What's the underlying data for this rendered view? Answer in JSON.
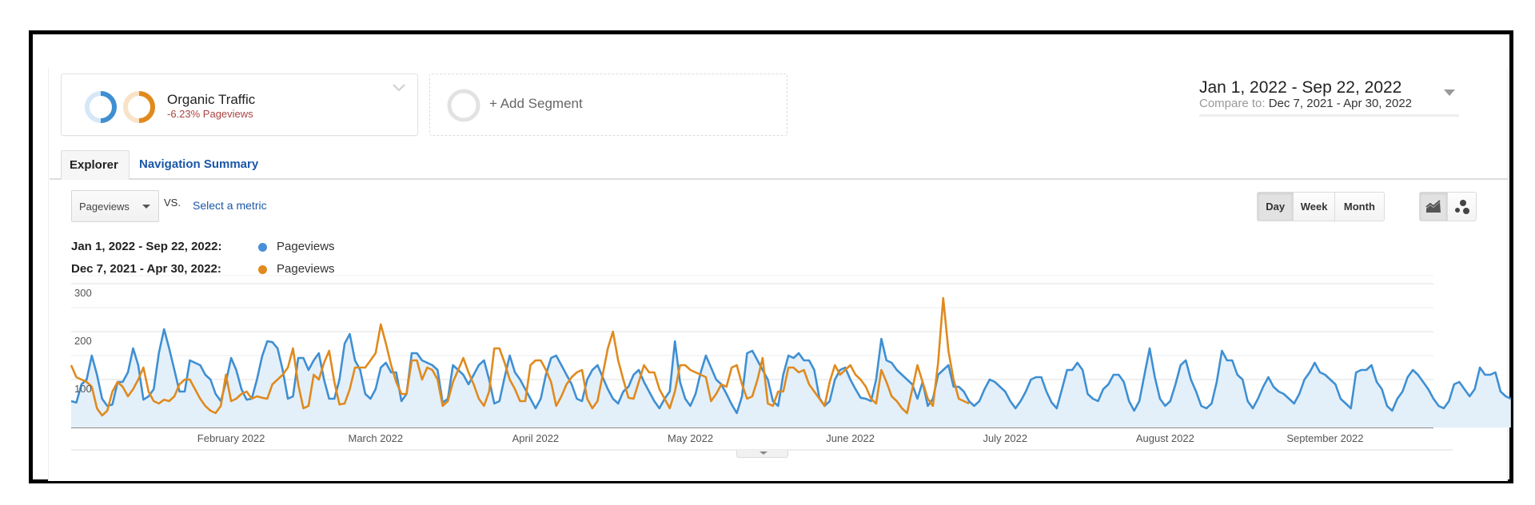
{
  "segment": {
    "name": "Organic Traffic",
    "change": "-6.23% Pageviews",
    "add_label": "+ Add Segment"
  },
  "date_range": {
    "primary": "Jan 1, 2022 - Sep 22, 2022",
    "compare_prefix": "Compare to: ",
    "compare": "Dec 7, 2021 - Apr 30, 2022"
  },
  "tabs": [
    {
      "label": "Explorer",
      "active": true
    },
    {
      "label": "Navigation Summary",
      "active": false
    }
  ],
  "toolbar": {
    "metric": "Pageviews",
    "vs_label": "VS.",
    "select_metric": "Select a metric",
    "period_buttons": [
      "Day",
      "Week",
      "Month"
    ],
    "active_period": "Day",
    "view_icons": [
      "line-chart-icon",
      "motion-chart-icon"
    ]
  },
  "legend": [
    {
      "range": "Jan 1, 2022 - Sep 22, 2022:",
      "metric": "Pageviews",
      "color": "#4a90d9"
    },
    {
      "range": "Dec 7, 2021 - Apr 30, 2022:",
      "metric": "Pageviews",
      "color": "#e08a1e"
    }
  ],
  "colors": {
    "primary": "#3f8fd2",
    "compare": "#e08a1e",
    "area_fill": "#e3f0fa",
    "negative_change": "#a94442",
    "link": "#1a57a8"
  },
  "chart_data": {
    "type": "line",
    "title": "",
    "xlabel": "",
    "ylabel": "Pageviews",
    "ylim": [
      0,
      300
    ],
    "yticks": [
      100,
      200,
      300
    ],
    "grid": true,
    "legend_position": "top-left",
    "x_tick_labels": [
      {
        "label": "February 2022",
        "day_index": 31
      },
      {
        "label": "March 2022",
        "day_index": 59
      },
      {
        "label": "April 2022",
        "day_index": 90
      },
      {
        "label": "May 2022",
        "day_index": 120
      },
      {
        "label": "June 2022",
        "day_index": 151
      },
      {
        "label": "July 2022",
        "day_index": 181
      },
      {
        "label": "August 2022",
        "day_index": 212
      },
      {
        "label": "September 2022",
        "day_index": 243
      }
    ],
    "total_days": 265,
    "series": [
      {
        "name": "Pageviews (Jan 1, 2022 - Sep 22, 2022)",
        "filled": true,
        "values": [
          55,
          52,
          90,
          100,
          150,
          110,
          60,
          45,
          48,
          95,
          95,
          115,
          165,
          130,
          58,
          65,
          80,
          155,
          205,
          165,
          120,
          75,
          75,
          140,
          135,
          130,
          110,
          100,
          70,
          55,
          95,
          145,
          120,
          80,
          58,
          60,
          100,
          148,
          180,
          178,
          165,
          120,
          60,
          65,
          145,
          145,
          120,
          140,
          155,
          100,
          60,
          60,
          100,
          175,
          195,
          140,
          120,
          70,
          60,
          80,
          125,
          135,
          115,
          115,
          55,
          70,
          155,
          155,
          140,
          135,
          130,
          120,
          52,
          60,
          130,
          120,
          110,
          90,
          110,
          130,
          140,
          100,
          50,
          55,
          105,
          150,
          115,
          100,
          80,
          60,
          40,
          60,
          110,
          145,
          150,
          130,
          110,
          90,
          60,
          55,
          100,
          120,
          130,
          105,
          80,
          60,
          50,
          75,
          85,
          110,
          120,
          95,
          75,
          55,
          40,
          60,
          75,
          180,
          95,
          60,
          45,
          70,
          115,
          150,
          125,
          100,
          90,
          70,
          48,
          30,
          65,
          155,
          160,
          140,
          120,
          100,
          55,
          45,
          110,
          150,
          145,
          155,
          140,
          140,
          120,
          62,
          45,
          55,
          100,
          120,
          125,
          100,
          80,
          62,
          60,
          55,
          100,
          185,
          140,
          135,
          120,
          110,
          100,
          90,
          60,
          95,
          45,
          60,
          110,
          120,
          130,
          85,
          85,
          75,
          55,
          45,
          55,
          80,
          100,
          95,
          85,
          75,
          55,
          40,
          55,
          75,
          100,
          105,
          105,
          75,
          52,
          40,
          80,
          120,
          120,
          135,
          120,
          70,
          60,
          55,
          80,
          90,
          110,
          110,
          95,
          55,
          35,
          55,
          110,
          165,
          105,
          60,
          45,
          55,
          90,
          130,
          140,
          100,
          75,
          45,
          40,
          50,
          95,
          160,
          140,
          140,
          110,
          100,
          55,
          40,
          60,
          85,
          105,
          85,
          75,
          70,
          60,
          50,
          70,
          100,
          115,
          135,
          115,
          110,
          100,
          90,
          60,
          50,
          40,
          115,
          120,
          120,
          130,
          95,
          80,
          45,
          35,
          60,
          75,
          105,
          120,
          110,
          95,
          80,
          60,
          45,
          40,
          55,
          90,
          95,
          80,
          65,
          80,
          125,
          110,
          110,
          115,
          75,
          65,
          60
        ],
        "color": "#3f8fd2"
      },
      {
        "name": "Pageviews (Dec 7, 2021 - Apr 30, 2022)",
        "filled": false,
        "values": [
          130,
          105,
          100,
          95,
          85,
          40,
          25,
          35,
          75,
          95,
          85,
          65,
          80,
          100,
          125,
          75,
          55,
          50,
          58,
          55,
          65,
          90,
          100,
          100,
          80,
          60,
          45,
          35,
          30,
          45,
          110,
          55,
          60,
          70,
          75,
          60,
          65,
          62,
          60,
          90,
          100,
          110,
          125,
          165,
          90,
          40,
          45,
          110,
          100,
          135,
          160,
          95,
          48,
          50,
          80,
          125,
          125,
          125,
          140,
          155,
          215,
          175,
          130,
          95,
          70,
          70,
          140,
          140,
          100,
          125,
          120,
          100,
          45,
          55,
          95,
          120,
          145,
          115,
          90,
          60,
          45,
          75,
          165,
          165,
          135,
          100,
          80,
          55,
          55,
          130,
          140,
          140,
          120,
          95,
          45,
          65,
          90,
          105,
          115,
          120,
          60,
          40,
          55,
          110,
          165,
          200,
          140,
          100,
          62,
          60,
          95,
          130,
          115,
          115,
          80,
          60,
          40,
          75,
          130,
          130,
          120,
          115,
          110,
          105,
          55,
          70,
          90,
          85,
          125,
          130,
          90,
          60,
          65,
          100,
          145,
          50,
          45,
          75,
          75,
          125,
          125,
          115,
          120,
          90,
          75,
          60,
          45,
          95,
          130,
          110,
          120,
          130,
          110,
          100,
          85,
          60,
          50,
          120,
          95,
          65,
          55,
          40,
          30,
          80,
          130,
          95,
          60,
          45,
          135,
          270,
          160,
          100,
          60,
          55,
          50
        ]
      }
    ]
  }
}
